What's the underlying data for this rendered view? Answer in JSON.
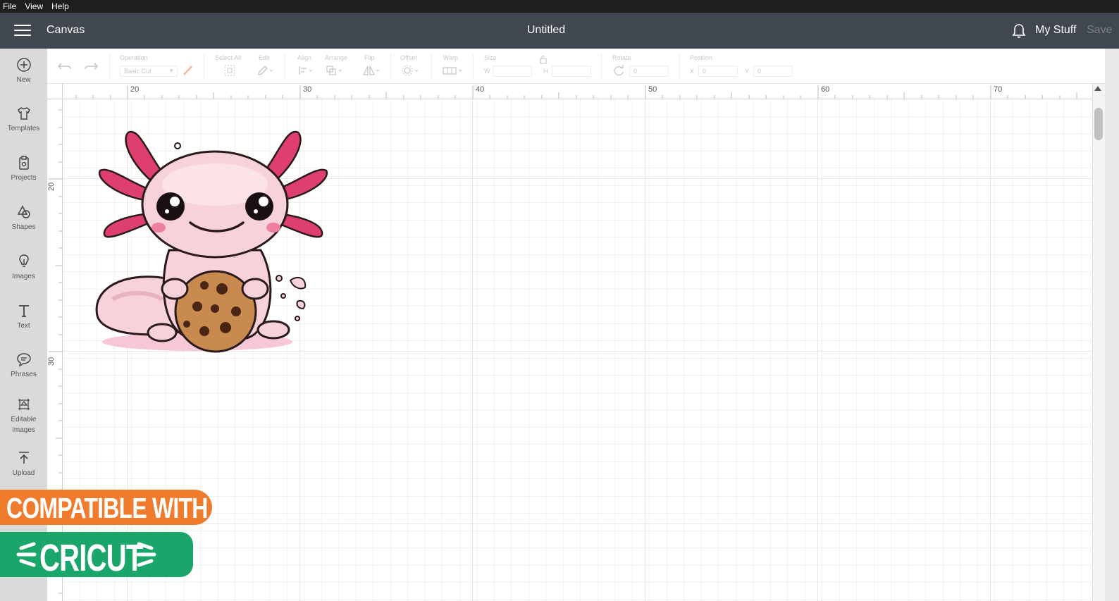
{
  "menubar": {
    "items": [
      "File",
      "View",
      "Help"
    ]
  },
  "header": {
    "app_title": "Canvas",
    "doc_title": "Untitled",
    "my_stuff": "My Stuff",
    "save": "Save"
  },
  "sidebar": {
    "items": [
      {
        "label": "New",
        "icon": "plus-circle-icon"
      },
      {
        "label": "Templates",
        "icon": "shirt-icon"
      },
      {
        "label": "Projects",
        "icon": "clipboard-icon"
      },
      {
        "label": "Shapes",
        "icon": "shapes-icon"
      },
      {
        "label": "Images",
        "icon": "lightbulb-icon"
      },
      {
        "label": "Text",
        "icon": "text-icon"
      },
      {
        "label": "Phrases",
        "icon": "speech-bubble-icon"
      },
      {
        "label": "Editable",
        "label2": "Images",
        "icon": "editable-image-icon"
      },
      {
        "label": "Upload",
        "icon": "upload-icon"
      }
    ]
  },
  "toolbar": {
    "operation": {
      "label": "Operation",
      "value": "Basic Cut"
    },
    "select_all": "Select All",
    "edit": "Edit",
    "align": "Align",
    "arrange": "Arrange",
    "flip": "Flip",
    "offset": "Offset",
    "warp": "Warp",
    "size": {
      "label": "Size",
      "w": "W",
      "h": "H"
    },
    "rotate": {
      "label": "Rotate",
      "value": "0"
    },
    "position": {
      "label": "Position",
      "x": "X",
      "x_value": "0",
      "y": "Y",
      "y_value": "0"
    }
  },
  "ruler": {
    "top_labels": [
      "20",
      "30",
      "40",
      "50",
      "60",
      "70"
    ],
    "left_labels": [
      "20",
      "30"
    ]
  },
  "badges": {
    "compatible": "COMPATIBLE WITH",
    "brand": "CRICUT"
  },
  "colors": {
    "header": "#414750",
    "sidebar": "#dadada",
    "orange": "#f07b2c",
    "green": "#1aa56a"
  }
}
